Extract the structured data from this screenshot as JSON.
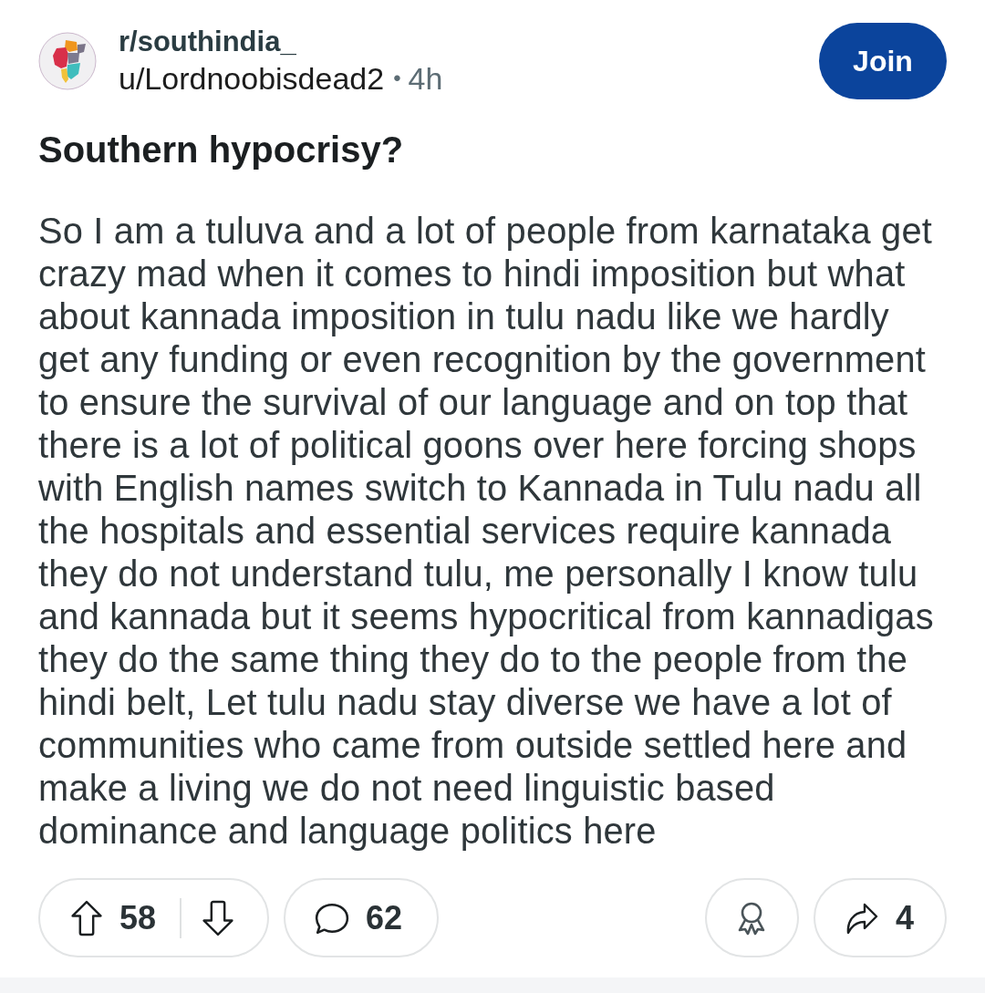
{
  "post": {
    "community": "r/southindia_",
    "author": "u/Lordnoobisdead2",
    "separator": "•",
    "age": "4h",
    "join_button": "Join",
    "title": "Southern hypocrisy?",
    "body": "So I am a tuluva and a lot of people from karnataka get crazy mad when it comes to hindi imposition but what about kannada imposition in tulu nadu like we hardly get any funding or even recognition by the government to ensure the survival of our language and on top that there is a lot of political goons over here forcing shops with English names switch to Kannada in Tulu nadu all the hospitals and essential services require kannada they do not understand tulu, me personally I know tulu and kannada but it seems hypocritical from kannadigas they do the same thing they do to the people from the hindi belt, Let tulu nadu stay diverse we have a lot of communities who came from outside settled here and make a living we do not need linguistic based dominance and language politics here"
  },
  "actions": [
    {
      "kind": "vote",
      "count": "58"
    },
    {
      "kind": "comment",
      "count": "62"
    },
    {
      "kind": "award"
    },
    {
      "kind": "share",
      "count": "4"
    }
  ]
}
